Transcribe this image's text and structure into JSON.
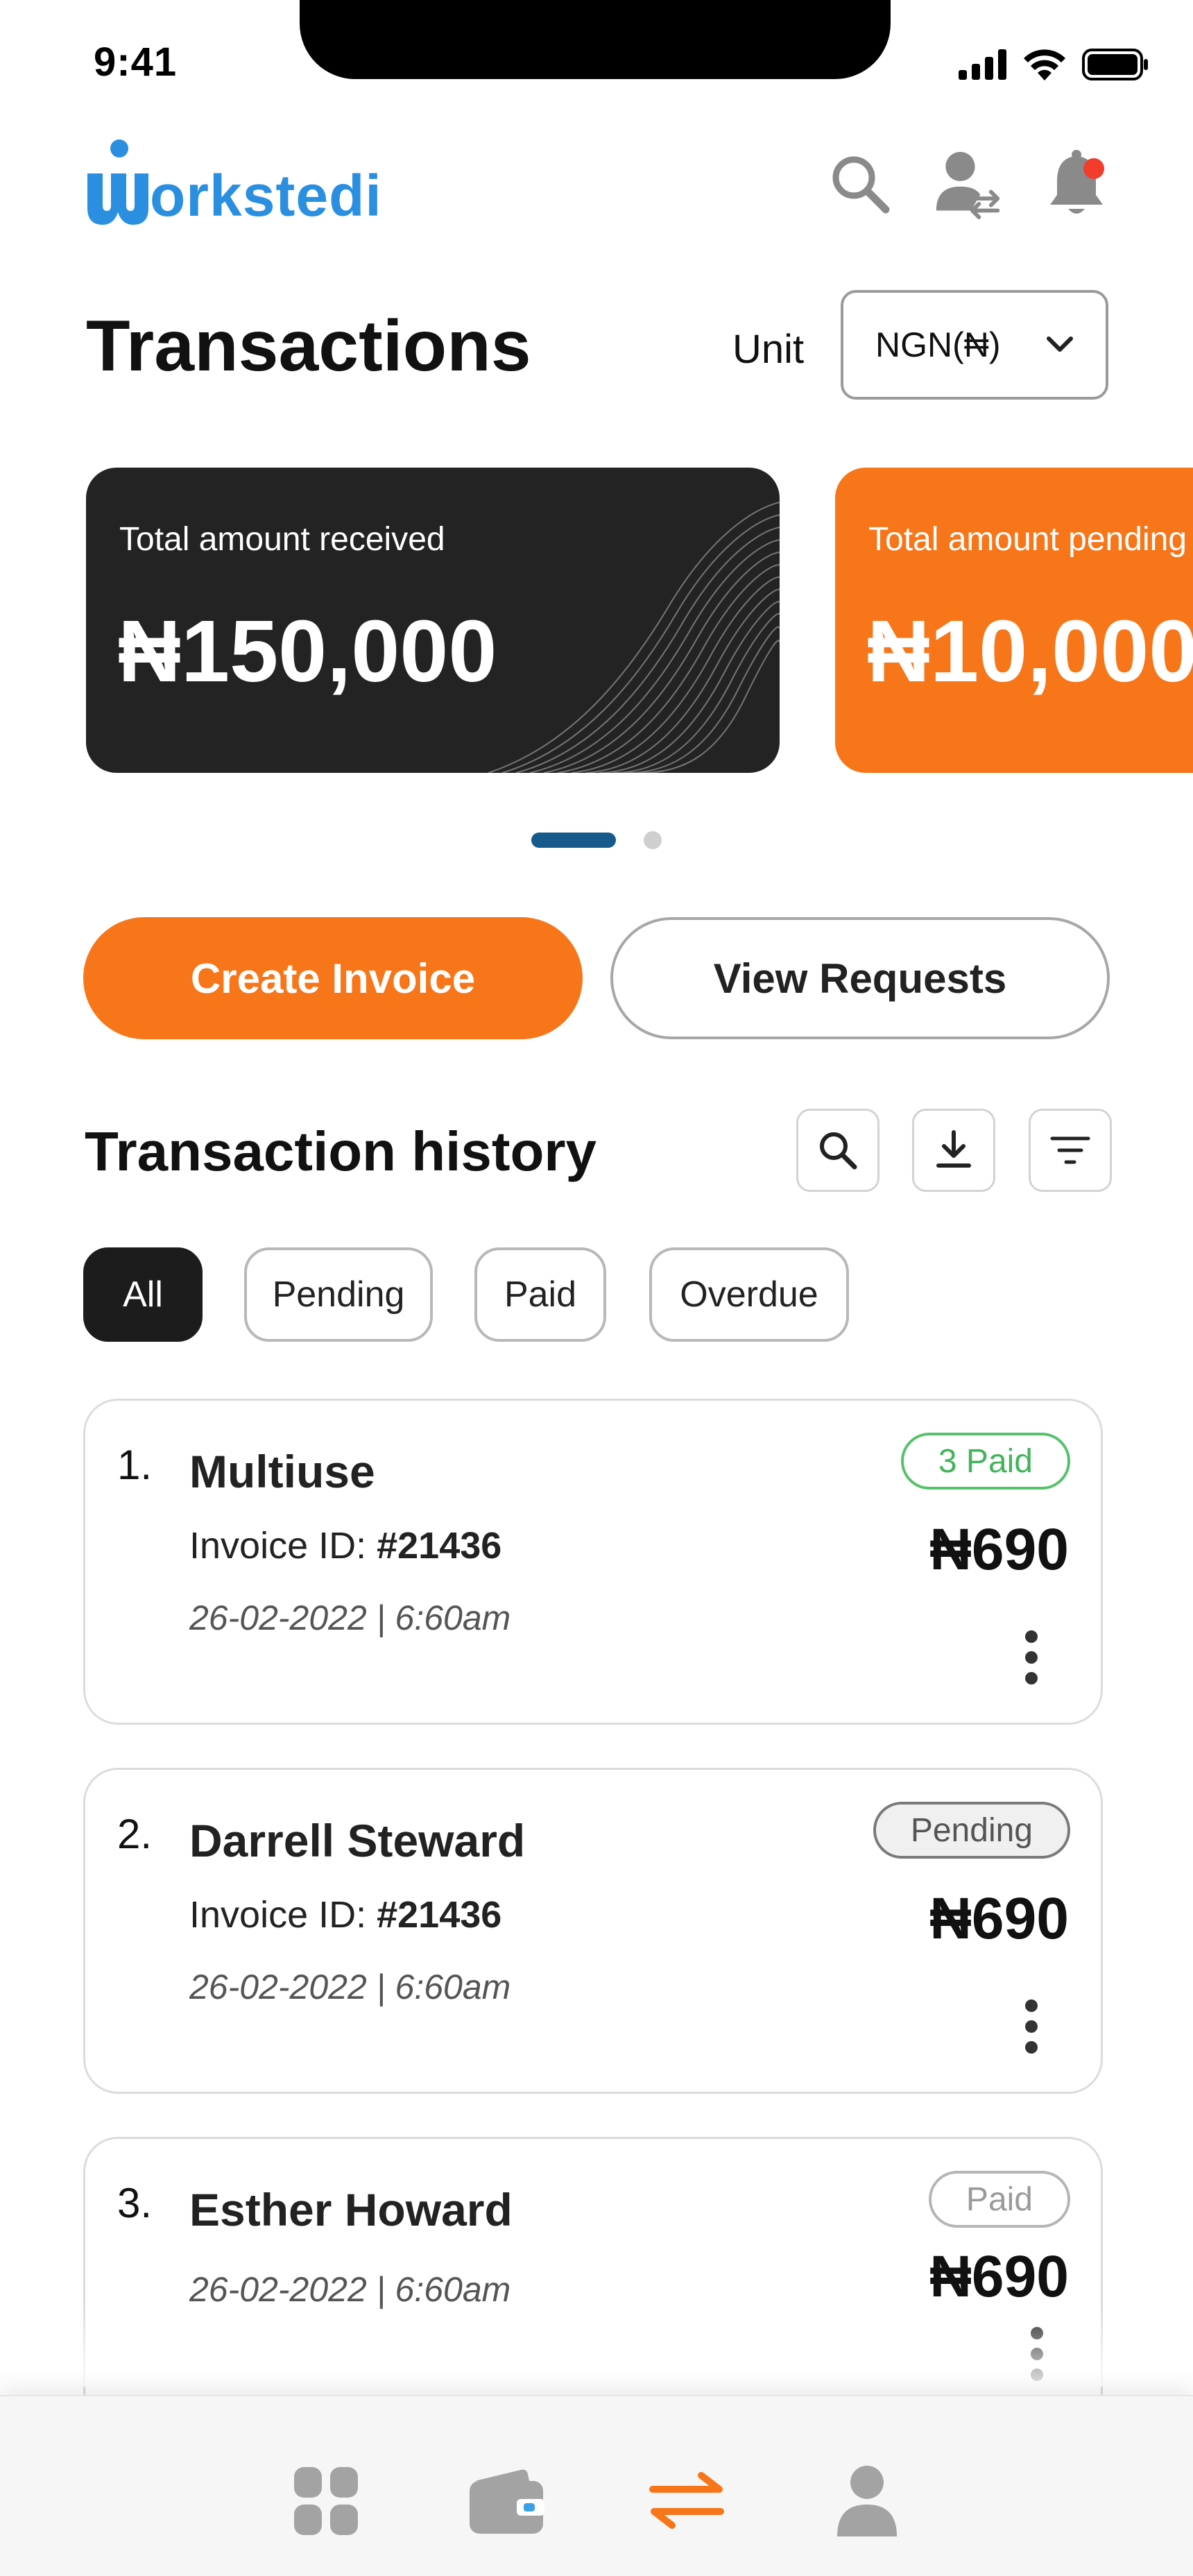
{
  "status_bar": {
    "time": "9:41"
  },
  "header": {
    "logo_text": "orkstedi",
    "icons": [
      "search-icon",
      "user-switch-icon",
      "bell-icon"
    ]
  },
  "title_row": {
    "title": "Transactions",
    "unit_label": "Unit",
    "unit_value": "NGN(₦)"
  },
  "summary_cards": [
    {
      "label": "Total amount received",
      "amount": "₦150,000",
      "color": "#232323"
    },
    {
      "label": "Total amount pending",
      "amount": "₦10,000",
      "color": "#f7761a"
    }
  ],
  "carousel": {
    "active_index": 0,
    "count": 2
  },
  "actions": {
    "create_invoice": "Create Invoice",
    "view_requests": "View Requests"
  },
  "history": {
    "title": "Transaction history",
    "tools": [
      "search-icon",
      "download-icon",
      "filter-icon"
    ]
  },
  "filters": [
    {
      "label": "All",
      "active": true
    },
    {
      "label": "Pending",
      "active": false
    },
    {
      "label": "Paid",
      "active": false
    },
    {
      "label": "Overdue",
      "active": false
    }
  ],
  "transactions": [
    {
      "num": "1.",
      "name": "Multiuse",
      "invoice_label": "Invoice ID: ",
      "invoice_id": "#21436",
      "date": "26-02-2022 | 6:60am",
      "status": "3 Paid",
      "amount": "₦690"
    },
    {
      "num": "2.",
      "name": "Darrell Steward",
      "invoice_label": "Invoice ID: ",
      "invoice_id": "#21436",
      "date": "26-02-2022 | 6:60am",
      "status": "Pending",
      "amount": "₦690"
    },
    {
      "num": "3.",
      "name": "Esther Howard",
      "date": "26-02-2022 | 6:60am",
      "status": "Paid",
      "amount": "₦690"
    }
  ],
  "bottom_nav": {
    "items": [
      "dashboard-icon",
      "wallet-icon",
      "transactions-icon",
      "profile-icon"
    ],
    "active": "transactions-icon",
    "accent": "#f7761a"
  }
}
